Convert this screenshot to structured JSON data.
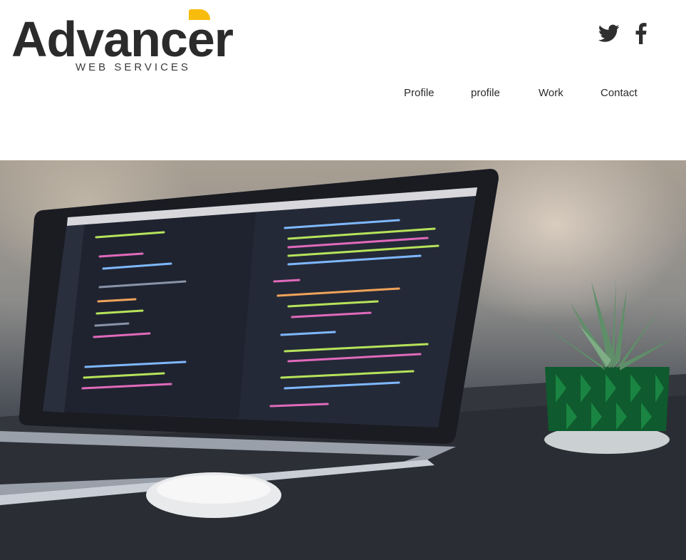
{
  "brand": {
    "name": "Advancer",
    "tagline": "WEB SERVICES",
    "accent_color": "#f8bc0c"
  },
  "social": [
    {
      "icon": "twitter-icon",
      "label": "Twitter"
    },
    {
      "icon": "facebook-icon",
      "label": "Facebook"
    }
  ],
  "nav": {
    "items": [
      {
        "label": "Profile"
      },
      {
        "label": "profile"
      },
      {
        "label": "Work"
      },
      {
        "label": "Contact"
      }
    ]
  },
  "hero": {
    "image_alt": "laptop-with-code-editor-and-succulent-plant"
  }
}
